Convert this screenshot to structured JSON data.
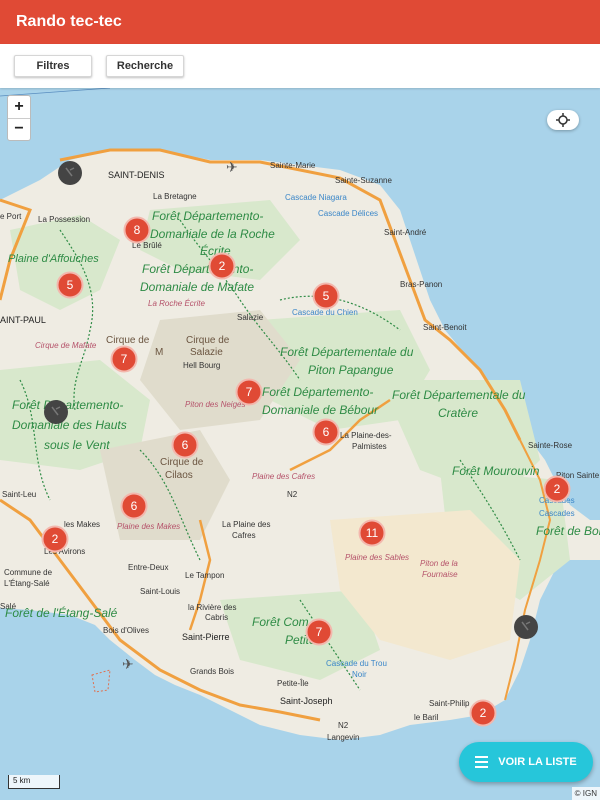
{
  "app": {
    "title": "Rando tec-tec"
  },
  "toolbar": {
    "filters_label": "Filtres",
    "search_label": "Recherche"
  },
  "map_controls": {
    "zoom_in": "+",
    "zoom_out": "−",
    "locate_icon": "crosshair-icon"
  },
  "list_button": {
    "label": "VOIR LA LISTE",
    "icon": "menu-icon"
  },
  "scale": {
    "label": "5 km"
  },
  "attribution": "© IGN",
  "colors": {
    "appbar": "#e04a35",
    "cluster": "#e04a35",
    "list_button": "#26c6da",
    "sea": "#a9d3ea",
    "land": "#efece3",
    "forest_text": "#2e8b45"
  },
  "clusters": [
    {
      "count": "8"
    },
    {
      "count": "2"
    },
    {
      "count": "5"
    },
    {
      "count": "5"
    },
    {
      "count": "7"
    },
    {
      "count": "7"
    },
    {
      "count": "6"
    },
    {
      "count": "6"
    },
    {
      "count": "6"
    },
    {
      "count": "2"
    },
    {
      "count": "11"
    },
    {
      "count": "2"
    },
    {
      "count": "7"
    },
    {
      "count": "2"
    }
  ],
  "places": {
    "saint_denis": "SAINT-DENIS",
    "sainte_marie": "Sainte-Marie",
    "sainte_suzanne": "Sainte-Suzanne",
    "saint_andre": "Saint-André",
    "bras_panon": "Bras-Panon",
    "saint_benoit": "Saint-Benoit",
    "sainte_rose": "Sainte-Rose",
    "piton_sainte_rose": "Piton Sainte",
    "la_possession": "La Possession",
    "le_port": "e Port",
    "saint_paul": "AINT-PAUL",
    "saint_leu": "Saint-Leu",
    "les_makes": "les Makes",
    "les_avirons": "Les Avirons",
    "commune_etang_sale": "Commune de",
    "etang_sale": "L'Étang-Salé",
    "etang_sale_short": "Salé",
    "entre_deux": "Entre-Deux",
    "le_tampon": "Le Tampon",
    "saint_louis": "Saint-Louis",
    "la_riviere_cabris_1": "la Rivière des",
    "la_riviere_cabris_2": "Cabris",
    "bois_olives": "Bois d'Olives",
    "saint_pierre": "Saint-Pierre",
    "grands_bois": "Grands Bois",
    "petite_ile": "Petite-Île",
    "saint_joseph": "Saint-Joseph",
    "langevin": "Langevin",
    "saint_philippe": "Saint-Philip",
    "le_baril": "le Baril",
    "salazie": "Salazie",
    "hell_bourg": "Hell Bourg",
    "la_plaine_palmistes_1": "La Plaine-des-",
    "la_plaine_palmistes_2": "Palmistes",
    "la_plaine_cafres_1": "La Plaine des",
    "la_plaine_cafres_2": "Cafres",
    "la_bretagne": "La Bretagne",
    "le_brule": "Le Brûlé",
    "plaine_affouches": "Plaine d'Affouches",
    "cirque_mafate": "Cirque de Mafate",
    "cirque_salazie_1": "Cirque de",
    "cirque_salazie_2": "Salazie",
    "cirque_cilaos_1": "Cirque de",
    "cirque_cilaos_2": "Cilaos",
    "cirque_mafate_2": "Cirque de",
    "cirque_mafate_3": "M",
    "roche_ecrite": "La Roche Écrite",
    "piton_neiges": "Piton des Neiges",
    "plaine_cafres_terrain": "Plaine des Cafres",
    "plaine_sables": "Plaine des Sables",
    "piton_fournaise_1": "Piton de la",
    "piton_fournaise_2": "Fournaise",
    "plaine_makes": "Plaine des Makes",
    "cascade_niagara": "Cascade Niagara",
    "cascade_delices": "Cascade Délices",
    "cascade_chien": "Cascade du Chien",
    "cascade_trou_noir_1": "Cascade du Trou",
    "cascade_trou_noir_2": "Noir",
    "cascades_1": "Cascades",
    "cascades_2": "Cascades",
    "n2_a": "N2",
    "n2_b": "N2"
  },
  "forests": {
    "roche_1": "Forêt Départemento-",
    "roche_2": "Domaniale de la Roche",
    "roche_3": "Écrite",
    "mafate_1": "Forêt Départemento-",
    "mafate_2": "Domaniale de Mafate",
    "hauts_1": "Forêt Départemento-",
    "hauts_2": "Domaniale des Hauts",
    "hauts_3": "sous le Vent",
    "papangue_1": "Forêt Départementale du",
    "papangue_2": "Piton Papangue",
    "bebour_1": "Forêt Départemento-",
    "bebour_2": "Domaniale de Bébour",
    "cratere_1": "Forêt Départementale du",
    "cratere_2": "Cratère",
    "mourouvin": "Forêt Mourouvin",
    "boi": "Forêt de Boi",
    "etang_sale": "Forêt de l'Étang-Salé",
    "petite_1": "Forêt Com",
    "petite_2": "Petite"
  }
}
